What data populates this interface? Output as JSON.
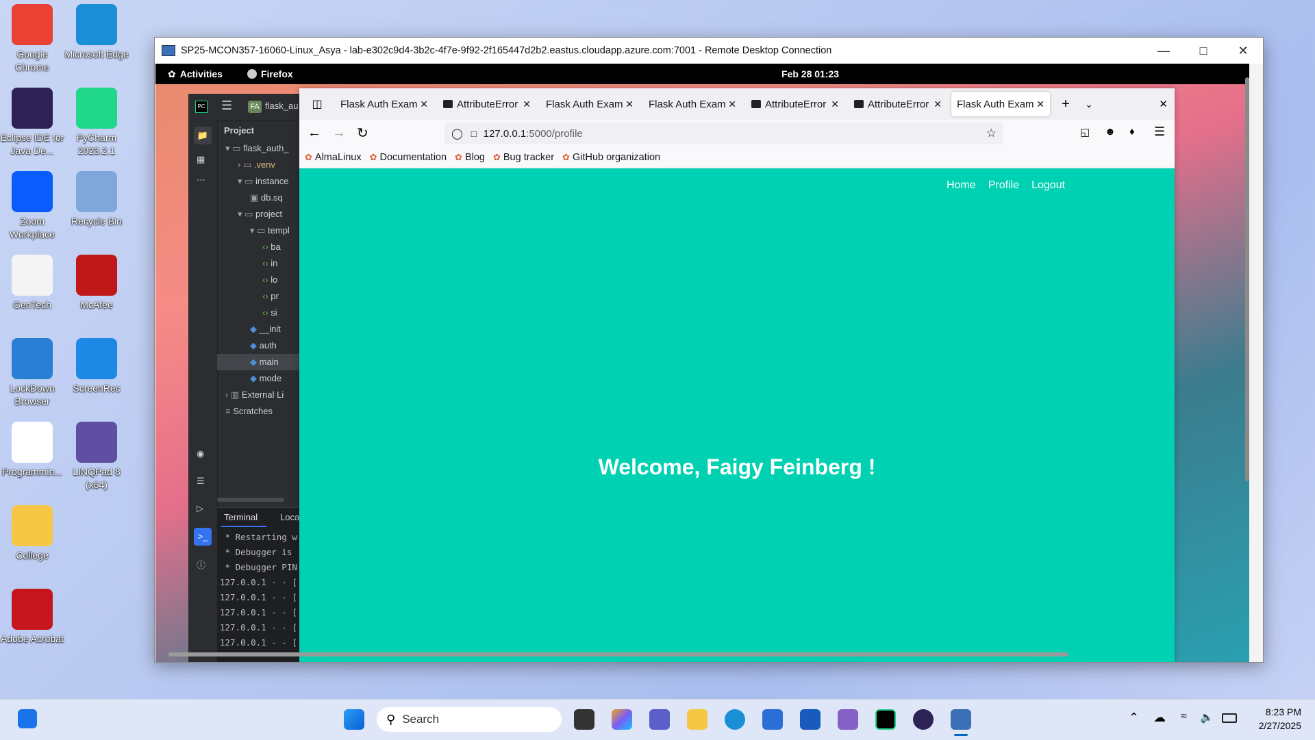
{
  "desktop": {
    "icons": [
      {
        "label": "Google Chrome",
        "color": "#e94235"
      },
      {
        "label": "Microsoft Edge",
        "color": "#1b8fd6"
      },
      {
        "label": "Eclipse IDE for Java De...",
        "color": "#2c2255"
      },
      {
        "label": "PyCharm 2023.2.1",
        "color": "#21d789"
      },
      {
        "label": "Zoom Workplace",
        "color": "#0b5cff"
      },
      {
        "label": "Recycle Bin",
        "color": "#7fa7d9"
      },
      {
        "label": "GenTech",
        "color": "#f4f4f4"
      },
      {
        "label": "McAfee",
        "color": "#c01818"
      },
      {
        "label": "LockDown Browser",
        "color": "#2a7fd4"
      },
      {
        "label": "ScreenRec",
        "color": "#1e88e5"
      },
      {
        "label": "Programmin...",
        "color": "#ffffff"
      },
      {
        "label": "LINQPad 8 (x64)",
        "color": "#5e4fa2"
      },
      {
        "label": "College",
        "color": "#f6c744"
      },
      {
        "label": "Adobe Acrobat",
        "color": "#c4161c"
      }
    ]
  },
  "rdp": {
    "title": "SP25-MCON357-16060-Linux_Asya - lab-e302c9d4-3b2c-4f7e-9f92-2f165447d2b2.eastus.cloudapp.azure.com:7001 - Remote Desktop Connection"
  },
  "gnome": {
    "activities": "Activities",
    "app": "Firefox",
    "clock": "Feb 28  01:23"
  },
  "pycharm": {
    "project_badge": "FA",
    "project_name": "flask_au",
    "project_label": "Project",
    "tree": [
      {
        "label": "flask_auth_",
        "indent": 0,
        "kind": "folder-open"
      },
      {
        "label": ".venv",
        "indent": 1,
        "kind": "folder"
      },
      {
        "label": "instance",
        "indent": 1,
        "kind": "folder-open"
      },
      {
        "label": "db.sq",
        "indent": 2,
        "kind": "file"
      },
      {
        "label": "project",
        "indent": 1,
        "kind": "folder-open"
      },
      {
        "label": "templ",
        "indent": 2,
        "kind": "folder-open"
      },
      {
        "label": "ba",
        "indent": 3,
        "kind": "html"
      },
      {
        "label": "in",
        "indent": 3,
        "kind": "html"
      },
      {
        "label": "lo",
        "indent": 3,
        "kind": "html"
      },
      {
        "label": "pr",
        "indent": 3,
        "kind": "html"
      },
      {
        "label": "si",
        "indent": 3,
        "kind": "html"
      },
      {
        "label": "__init",
        "indent": 2,
        "kind": "py"
      },
      {
        "label": "auth",
        "indent": 2,
        "kind": "py"
      },
      {
        "label": "main",
        "indent": 2,
        "kind": "py"
      },
      {
        "label": "mode",
        "indent": 2,
        "kind": "py"
      },
      {
        "label": "External Li",
        "indent": 0,
        "kind": "lib"
      },
      {
        "label": "Scratches",
        "indent": 0,
        "kind": "scratch"
      }
    ],
    "terminal_tab": "Terminal",
    "local_tab": "Loca",
    "terminal_lines": [
      " * Restarting w",
      " * Debugger is ",
      " * Debugger PIN",
      "127.0.0.1 - - [",
      "127.0.0.1 - - [",
      "127.0.0.1 - - [",
      "127.0.0.1 - - [",
      "127.0.0.1 - - ["
    ]
  },
  "firefox": {
    "tabs": [
      {
        "title": "Flask Auth Examp",
        "icon": "none",
        "active": false
      },
      {
        "title": "AttributeError",
        "icon": "terminal",
        "active": false
      },
      {
        "title": "Flask Auth Examp",
        "icon": "none",
        "active": false
      },
      {
        "title": "Flask Auth Examp",
        "icon": "none",
        "active": false
      },
      {
        "title": "AttributeError",
        "icon": "terminal",
        "active": false
      },
      {
        "title": "AttributeError",
        "icon": "terminal",
        "active": false
      },
      {
        "title": "Flask Auth Examp",
        "icon": "none",
        "active": true
      }
    ],
    "url_host": "127.0.0.1",
    "url_path": ":5000/profile",
    "bookmarks": [
      "AlmaLinux",
      "Documentation",
      "Blog",
      "Bug tracker",
      "GitHub organization"
    ]
  },
  "webpage": {
    "nav": [
      "Home",
      "Profile",
      "Logout"
    ],
    "welcome": "Welcome, Faigy Feinberg !",
    "bg_color": "#00d1b2"
  },
  "taskbar": {
    "search_placeholder": "Search",
    "time": "8:23 PM",
    "date": "2/27/2025"
  }
}
